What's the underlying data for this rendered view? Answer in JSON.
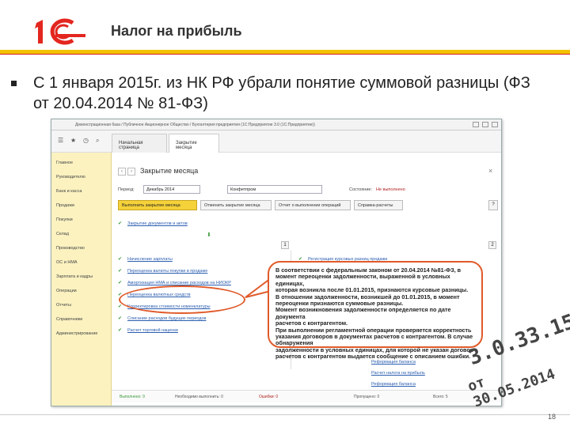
{
  "slide": {
    "title": "Налог на прибыль",
    "bullet": "С 1 января 2015г. из НК РФ убрали понятие суммовой разницы (ФЗ от 20.04.2014 № 81-ФЗ)",
    "page_number": "18",
    "stamp_line1": "3.0.33.15",
    "stamp_line2": "от 30.05.2014"
  },
  "app": {
    "window_title": "Демонстрационная база / Публичное Акционерное Общество / Бухгалтерия предприятия (1С:Предприятие 3.0 (1С:Предприятие))",
    "tabs": [
      "Начальная страница",
      "Закрытие месяца"
    ],
    "sidebar": [
      "Главное",
      "Руководителю",
      "Банк и касса",
      "Продажи",
      "Покупки",
      "Склад",
      "Производство",
      "ОС и НМА",
      "Зарплата и кадры",
      "Операции",
      "Отчеты",
      "Справочники",
      "Администрирование"
    ],
    "document_title": "Закрытие месяца",
    "period_label": "Период:",
    "period_value": "Декабрь 2014",
    "org_value": "Конфетпром",
    "state_label": "Состояние:",
    "state_value": "Не выполнено",
    "buttons": {
      "run": "Выполнить закрытие месяца",
      "cancel": "Отменить закрытие месяца",
      "report": "Отчет о выполнении операций",
      "info": "Справка-расчеты",
      "help": "?"
    },
    "top_link": "Закрытие документов и актов",
    "col1_num": "1",
    "col2_num": "2",
    "left_ops": [
      "Начисление зарплаты",
      "Переоценка валюты покупки в продаже",
      "Амортизация НМА и списание расходов на НИОКР",
      "Переоценка валютных средств",
      "Корректировка стоимости номенклатуры",
      "Списание расходов будущих периодов",
      "Расчет торговой наценки"
    ],
    "right_ops": [
      "Регистрация курсовых разниц продажи"
    ],
    "bottom_links": [
      "Реформация баланса",
      "Расчет налога на прибыль",
      "Реформация баланса"
    ],
    "status_items": [
      "Выполнено: 9",
      "Необходимо выполнить: 0",
      "Ошибки: 0",
      "Пропущено: 0",
      "Всего: 5"
    ]
  },
  "callout": {
    "lines": [
      "В соответствии с федеральным законом от 20.04.2014 №81-ФЗ, в",
      "момент переоценки задолженности, выраженной в условных единицах,",
      "которая возникла после 01.01.2015, признаются курсовые разницы.",
      "В отношении задолженности, возникшей до 01.01.2015, в момент",
      "переоценки признаются суммовые разницы.",
      "Момент возникновения задолженности определяется по дате документа",
      "расчетов с контрагентом.",
      "При выполнении регламентной операции проверяется корректность",
      "указания договоров в документах расчетов с контрагентом. В случае обнаружения",
      "задолженности в условных единицах, для которой не указан договор",
      "расчетов с контрагентом выдается сообщение с описанием ошибки."
    ]
  }
}
